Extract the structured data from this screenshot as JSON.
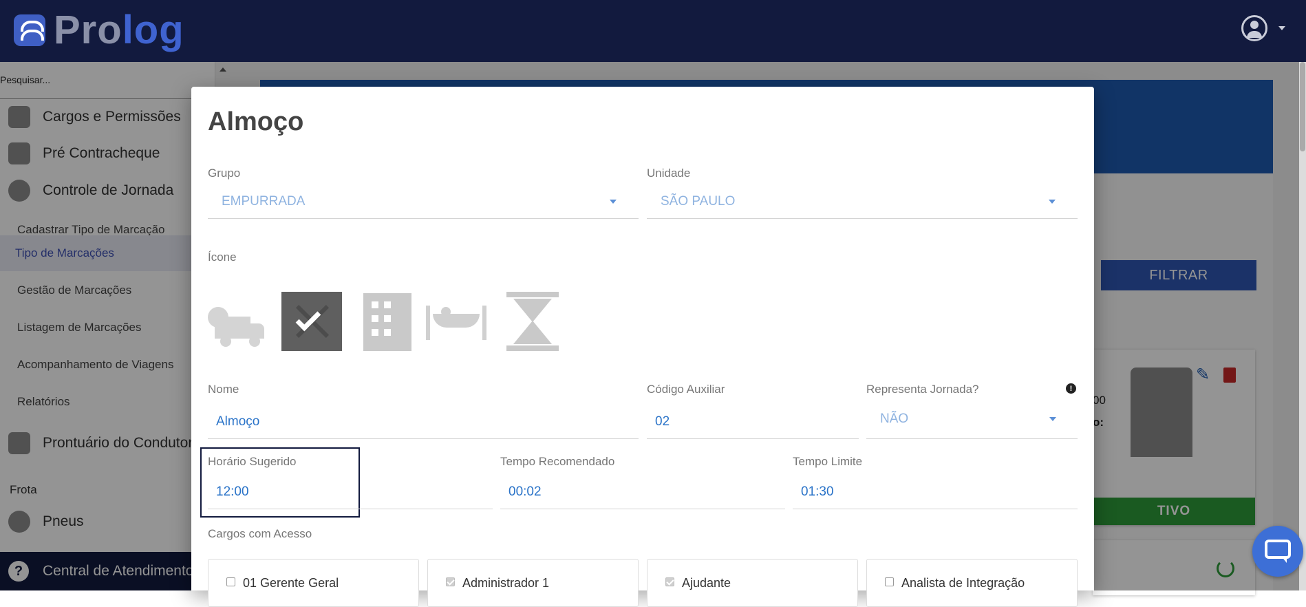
{
  "app": {
    "logo_pro": "Pro",
    "logo_log": "log"
  },
  "sidebar": {
    "search_placeholder": "Pesquisar...",
    "items": [
      {
        "label": "Cargos e Permissões",
        "icon": "badge-icon"
      },
      {
        "label": "Pré Contracheque",
        "icon": "wallet-icon"
      },
      {
        "label": "Controle de Jornada",
        "icon": "clock-icon"
      }
    ],
    "sub_items": [
      "Cadastrar Tipo de Marcação",
      "Tipo de Marcações",
      "Gestão de Marcações",
      "Listagem de Marcações",
      "Acompanhamento de Viagens",
      "Relatórios"
    ],
    "prontuario": "Prontuário do Condutor",
    "section_frota": "Frota",
    "pneus": "Pneus",
    "footer": "Central de Atendimento"
  },
  "background": {
    "filtrar": "FILTRAR",
    "card_text1": "00",
    "card_text2": "o:",
    "card_status": "TIVO"
  },
  "modal": {
    "title": "Almoço",
    "grupo_label": "Grupo",
    "grupo_value": "EMPURRADA",
    "unidade_label": "Unidade",
    "unidade_value": "SÃO PAULO",
    "icone_label": "Ícone",
    "icons": [
      "truck-clock-icon",
      "utensils-icon",
      "building-icon",
      "hammock-icon",
      "hourglass-icon"
    ],
    "selected_icon": "utensils-icon",
    "nome_label": "Nome",
    "nome_value": "Almoço",
    "codigo_label": "Código Auxiliar",
    "codigo_value": "02",
    "representa_label": "Representa Jornada?",
    "representa_value": "NÃO",
    "horario_label": "Horário Sugerido",
    "horario_value": "12:00",
    "tempo_rec_label": "Tempo Recomendado",
    "tempo_rec_value": "00:02",
    "tempo_lim_label": "Tempo Limite",
    "tempo_lim_value": "01:30",
    "cargos_label": "Cargos com Acesso",
    "cargos": [
      {
        "label": "01 Gerente Geral",
        "checked": false
      },
      {
        "label": "Administrador 1",
        "checked": true
      },
      {
        "label": "Ajudante",
        "checked": true
      },
      {
        "label": "Analista de Integração",
        "checked": false
      }
    ]
  },
  "colors": {
    "topbar": "#121a3e",
    "accent": "#2a73c8",
    "active_green": "#2e9c3a"
  }
}
